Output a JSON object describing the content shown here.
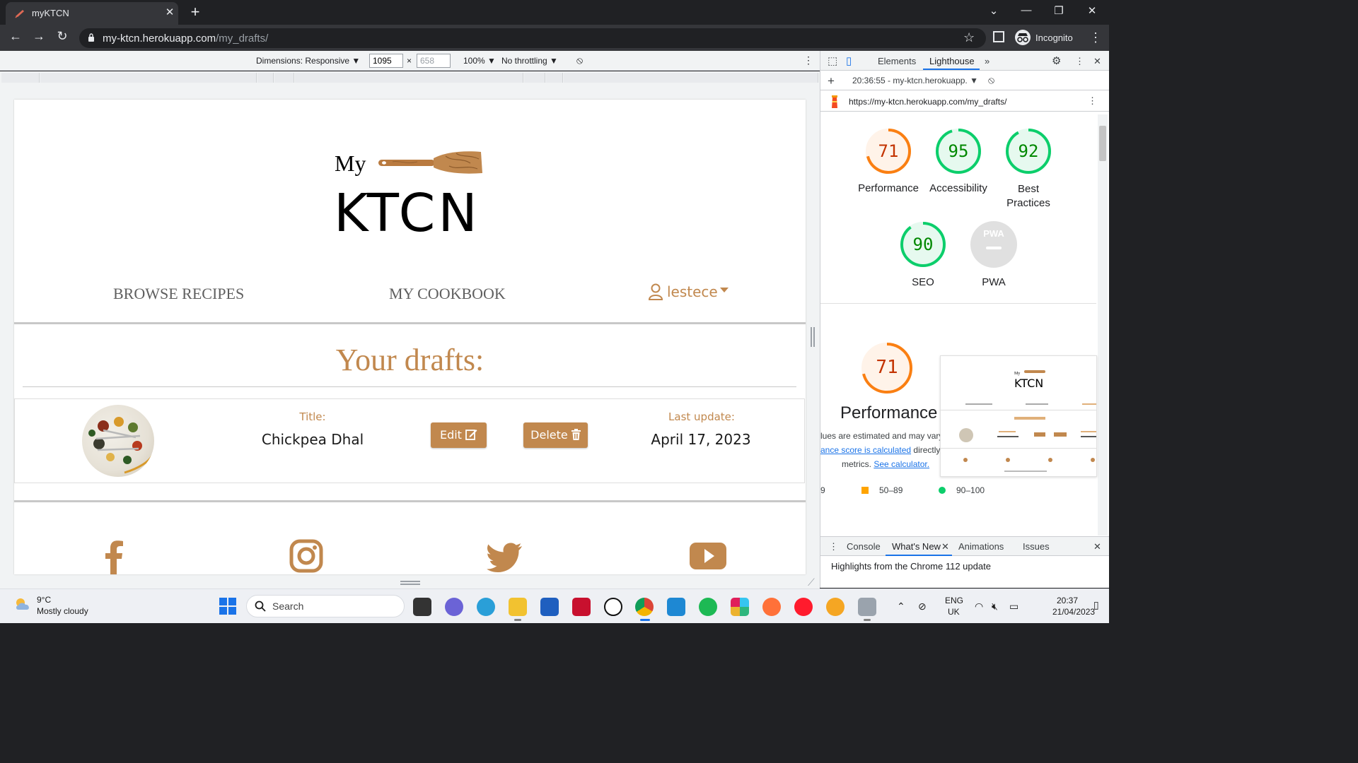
{
  "browser": {
    "tab_title": "myKTCN",
    "tab_close": "✕",
    "new_tab": "+",
    "url_host": "my-ktcn.herokuapp.com",
    "url_path": "/my_drafts/",
    "profile_label": "Incognito",
    "window_controls": [
      "⌄",
      "—",
      "❐",
      "✕"
    ]
  },
  "device_toolbar": {
    "dimensions_label": "Dimensions: Responsive ▼",
    "width": "1095",
    "times": "×",
    "height": "658",
    "zoom": "100% ▼",
    "throttling": "No throttling ▼"
  },
  "site": {
    "logo_small": "My",
    "logo_large": "KTCN",
    "nav": {
      "browse": "BROWSE RECIPES",
      "cookbook": "MY COOKBOOK",
      "user": "lestece"
    },
    "drafts_heading": "Your drafts:",
    "draft": {
      "title_label": "Title:",
      "title_value": "Chickpea Dhal",
      "edit_label": "Edit",
      "delete_label": "Delete",
      "updated_label": "Last update:",
      "updated_value": "April 17, 2023"
    },
    "social_icons": [
      "facebook-icon",
      "instagram-icon",
      "twitter-icon",
      "youtube-icon"
    ]
  },
  "devtools": {
    "tabs": [
      "Elements",
      "Lighthouse"
    ],
    "report_selector": "20:36:55 - my-ktcn.herokuapp. ▼",
    "report_url": "https://my-ktcn.herokuapp.com/my_drafts/",
    "scores": [
      {
        "label": "Performance",
        "score": "71",
        "color": "#fa7f12"
      },
      {
        "label": "Accessibility",
        "score": "95",
        "color": "#0cce6b"
      },
      {
        "label": "Best Practices",
        "score": "92",
        "color": "#0cce6b"
      },
      {
        "label": "SEO",
        "score": "90",
        "color": "#0cce6b"
      },
      {
        "label": "PWA",
        "score": "",
        "color": "#c8c8c8"
      }
    ],
    "perf_detail": {
      "score": "71",
      "title": "Performance",
      "note_1": "lues are estimated and may vary",
      "note_2_link": "ance score is calculated",
      "note_2_rest": " directly",
      "note_3_pre": "metrics. ",
      "note_3_link": "See calculator."
    },
    "legend": [
      {
        "text": "9",
        "color": ""
      },
      {
        "text": "50–89",
        "color": "#ffa400"
      },
      {
        "text": "90–100",
        "color": "#0cce6b"
      }
    ],
    "drawer_tabs": [
      "Console",
      "What's New",
      "Animations",
      "Issues"
    ],
    "drawer_text": "Highlights from the Chrome 112 update"
  },
  "taskbar": {
    "weather_temp": "9°C",
    "weather_desc": "Mostly cloudy",
    "search_label": "Search",
    "lang_1": "ENG",
    "lang_2": "UK",
    "time": "20:37",
    "date": "21/04/2023"
  },
  "colors": {
    "accent": "#c1884e",
    "perf_orange": "#fa7f12",
    "good_green": "#0cce6b"
  }
}
